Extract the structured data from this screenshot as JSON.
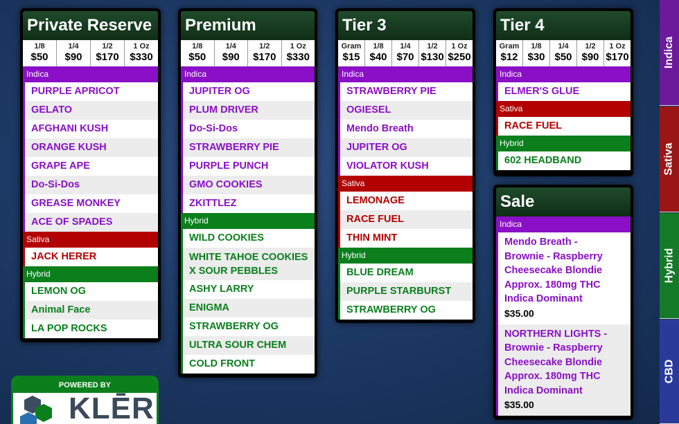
{
  "cards": {
    "private_reserve": {
      "title": "Private Reserve",
      "prices": [
        {
          "size": "1/8",
          "amount": "$50"
        },
        {
          "size": "1/4",
          "amount": "$90"
        },
        {
          "size": "1/2",
          "amount": "$170"
        },
        {
          "size": "1 Oz",
          "amount": "$330"
        }
      ],
      "indica_label": "Indica",
      "indica": [
        "PURPLE APRICOT",
        "GELATO",
        "AFGHANI KUSH",
        "ORANGE KUSH",
        "GRAPE APE",
        "Do-Si-Dos",
        "GREASE MONKEY",
        "ACE OF SPADES"
      ],
      "sativa_label": "Sativa",
      "sativa": [
        "JACK HERER"
      ],
      "hybrid_label": "Hybrid",
      "hybrid": [
        "LEMON OG",
        "Animal Face",
        "LA POP ROCKS"
      ]
    },
    "premium": {
      "title": "Premium",
      "prices": [
        {
          "size": "1/8",
          "amount": "$50"
        },
        {
          "size": "1/4",
          "amount": "$90"
        },
        {
          "size": "1/2",
          "amount": "$170"
        },
        {
          "size": "1 Oz",
          "amount": "$330"
        }
      ],
      "indica_label": "Indica",
      "indica": [
        "JUPITER OG",
        "PLUM DRIVER",
        "Do-Si-Dos",
        "STRAWBERRY PIE",
        "PURPLE PUNCH",
        "GMO COOKIES",
        "ZKITTLEZ"
      ],
      "hybrid_label": "Hybrid",
      "hybrid": [
        "WILD COOKIES",
        "WHITE TAHOE COOKIES X SOUR PEBBLES",
        "ASHY LARRY",
        "ENIGMA",
        "STRAWBERRY OG",
        "ULTRA SOUR CHEM",
        "COLD FRONT"
      ]
    },
    "tier3": {
      "title": "Tier 3",
      "prices": [
        {
          "size": "Gram",
          "amount": "$15"
        },
        {
          "size": "1/8",
          "amount": "$40"
        },
        {
          "size": "1/4",
          "amount": "$70"
        },
        {
          "size": "1/2",
          "amount": "$130"
        },
        {
          "size": "1 Oz",
          "amount": "$250"
        }
      ],
      "indica_label": "Indica",
      "indica": [
        "STRAWBERRY PIE",
        "OGIESEL",
        "Mendo Breath",
        "JUPITER OG",
        "VIOLATOR KUSH"
      ],
      "sativa_label": "Sativa",
      "sativa": [
        "LEMONAGE",
        "RACE FUEL",
        "THIN MINT"
      ],
      "hybrid_label": "Hybrid",
      "hybrid": [
        "BLUE DREAM",
        "PURPLE STARBURST",
        "STRAWBERRY OG"
      ]
    },
    "tier4": {
      "title": "Tier 4",
      "prices": [
        {
          "size": "Gram",
          "amount": "$12"
        },
        {
          "size": "1/8",
          "amount": "$30"
        },
        {
          "size": "1/4",
          "amount": "$50"
        },
        {
          "size": "1/2",
          "amount": "$90"
        },
        {
          "size": "1 Oz",
          "amount": "$170"
        }
      ],
      "indica_label": "Indica",
      "indica": [
        "ELMER'S GLUE"
      ],
      "sativa_label": "Sativa",
      "sativa": [
        "RACE FUEL"
      ],
      "hybrid_label": "Hybrid",
      "hybrid": [
        "602 HEADBAND"
      ]
    },
    "sale": {
      "title": "Sale",
      "indica_label": "Indica",
      "items": [
        {
          "name": "Mendo Breath -\nBrownie - Raspberry\nCheesecake Blondie\nApprox. 180mg THC\nIndica Dominant",
          "price": "$35.00"
        },
        {
          "name": "NORTHERN LIGHTS -\nBrownie - Raspberry\nCheesecake Blondie\nApprox. 180mg THC\nIndica Dominant",
          "price": "$35.00"
        }
      ]
    }
  },
  "side_tabs": [
    {
      "label": "Indica",
      "color": "#6a1a9a"
    },
    {
      "label": "Sativa",
      "color": "#9a1515"
    },
    {
      "label": "Hybrid",
      "color": "#137a27"
    },
    {
      "label": "CBD",
      "color": "#2a3a9a"
    }
  ],
  "logo": {
    "powered_by": "POWERED BY",
    "wordmark": "KLĒR"
  }
}
